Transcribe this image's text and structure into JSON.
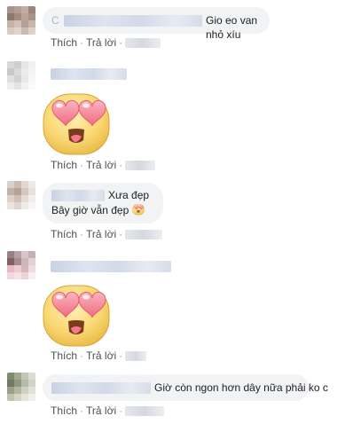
{
  "colors": {
    "bubble_bg": "#f2f3f5",
    "action_text": "#4b4f56",
    "blur_name": "#d2d9e7",
    "sticker_face": "#f9d873",
    "heart": "#f47a8c"
  },
  "actions": {
    "like": "Thích",
    "reply": "Trả lời",
    "separator": "·"
  },
  "comments": [
    {
      "author_initial": "C",
      "text": "Gio eo van nhỏ xíu"
    },
    {
      "sticker": "heart-eyes-sticker"
    },
    {
      "line1": "Xưa đẹp",
      "line2": "Bây giờ vẫn đẹp",
      "inline_emoji": "heart-eyes-emoji"
    },
    {
      "sticker": "heart-eyes-sticker"
    },
    {
      "text": "Giờ còn ngon hơn dây nữa phải ko c"
    }
  ]
}
